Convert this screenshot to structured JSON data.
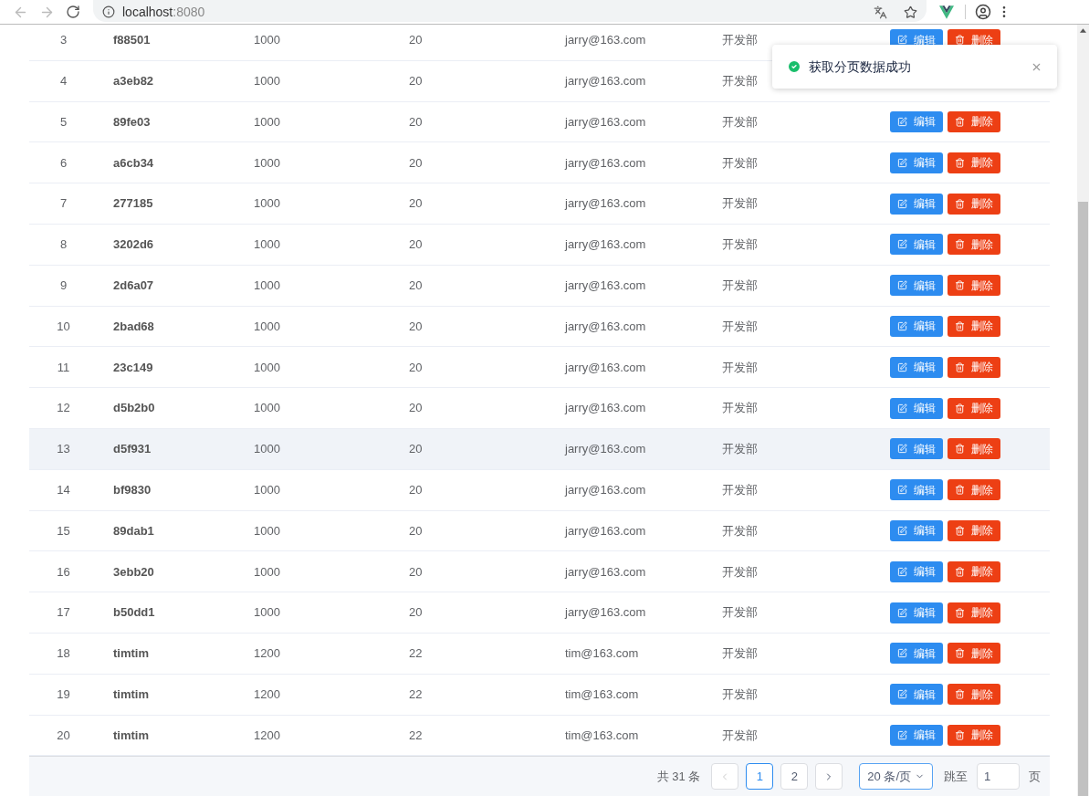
{
  "browser": {
    "url_host": "localhost",
    "url_port": ":8080"
  },
  "rows": [
    {
      "index": "3",
      "name": "f88501",
      "salary": "1000",
      "age": "20",
      "email": "jarry@163.com",
      "dept": "开发部",
      "hovered": false,
      "actions": [
        "编辑",
        "删除"
      ]
    },
    {
      "index": "4",
      "name": "a3eb82",
      "salary": "1000",
      "age": "20",
      "email": "jarry@163.com",
      "dept": "开发部",
      "hovered": false
    },
    {
      "index": "5",
      "name": "89fe03",
      "salary": "1000",
      "age": "20",
      "email": "jarry@163.com",
      "dept": "开发部",
      "hovered": false,
      "actions": [
        "编辑",
        "删除"
      ]
    },
    {
      "index": "6",
      "name": "a6cb34",
      "salary": "1000",
      "age": "20",
      "email": "jarry@163.com",
      "dept": "开发部",
      "hovered": false,
      "actions": [
        "编辑",
        "删除"
      ]
    },
    {
      "index": "7",
      "name": "277185",
      "salary": "1000",
      "age": "20",
      "email": "jarry@163.com",
      "dept": "开发部",
      "hovered": false,
      "actions": [
        "编辑",
        "删除"
      ]
    },
    {
      "index": "8",
      "name": "3202d6",
      "salary": "1000",
      "age": "20",
      "email": "jarry@163.com",
      "dept": "开发部",
      "hovered": false,
      "actions": [
        "编辑",
        "删除"
      ]
    },
    {
      "index": "9",
      "name": "2d6a07",
      "salary": "1000",
      "age": "20",
      "email": "jarry@163.com",
      "dept": "开发部",
      "hovered": false,
      "actions": [
        "编辑",
        "删除"
      ]
    },
    {
      "index": "10",
      "name": "2bad68",
      "salary": "1000",
      "age": "20",
      "email": "jarry@163.com",
      "dept": "开发部",
      "hovered": false,
      "actions": [
        "编辑",
        "删除"
      ]
    },
    {
      "index": "11",
      "name": "23c149",
      "salary": "1000",
      "age": "20",
      "email": "jarry@163.com",
      "dept": "开发部",
      "hovered": false,
      "actions": [
        "编辑",
        "删除"
      ]
    },
    {
      "index": "12",
      "name": "d5b2b0",
      "salary": "1000",
      "age": "20",
      "email": "jarry@163.com",
      "dept": "开发部",
      "hovered": false,
      "actions": [
        "编辑",
        "删除"
      ]
    },
    {
      "index": "13",
      "name": "d5f931",
      "salary": "1000",
      "age": "20",
      "email": "jarry@163.com",
      "dept": "开发部",
      "hovered": true,
      "actions": [
        "编辑",
        "删除"
      ]
    },
    {
      "index": "14",
      "name": "bf9830",
      "salary": "1000",
      "age": "20",
      "email": "jarry@163.com",
      "dept": "开发部",
      "hovered": false,
      "actions": [
        "编辑",
        "删除"
      ]
    },
    {
      "index": "15",
      "name": "89dab1",
      "salary": "1000",
      "age": "20",
      "email": "jarry@163.com",
      "dept": "开发部",
      "hovered": false,
      "actions": [
        "编辑",
        "删除"
      ]
    },
    {
      "index": "16",
      "name": "3ebb20",
      "salary": "1000",
      "age": "20",
      "email": "jarry@163.com",
      "dept": "开发部",
      "hovered": false,
      "actions": [
        "编辑",
        "删除"
      ]
    },
    {
      "index": "17",
      "name": "b50dd1",
      "salary": "1000",
      "age": "20",
      "email": "jarry@163.com",
      "dept": "开发部",
      "hovered": false,
      "actions": [
        "编辑",
        "删除"
      ]
    },
    {
      "index": "18",
      "name": "timtim",
      "salary": "1200",
      "age": "22",
      "email": "tim@163.com",
      "dept": "开发部",
      "hovered": false,
      "actions": [
        "编辑",
        "删除"
      ]
    },
    {
      "index": "19",
      "name": "timtim",
      "salary": "1200",
      "age": "22",
      "email": "tim@163.com",
      "dept": "开发部",
      "hovered": false,
      "actions": [
        "编辑",
        "删除"
      ]
    },
    {
      "index": "20",
      "name": "timtim",
      "salary": "1200",
      "age": "22",
      "email": "tim@163.com",
      "dept": "开发部",
      "hovered": false,
      "actions": [
        "编辑",
        "删除"
      ]
    }
  ],
  "pagination": {
    "total": "共 31 条",
    "pages": [
      {
        "label": "1",
        "selected": true
      },
      {
        "label": "2",
        "selected": false
      }
    ],
    "page_size": "20 条/页",
    "jump_label": "跳至",
    "jump_value": "1",
    "page_suffix": "页"
  },
  "toast": {
    "message": "获取分页数据成功"
  }
}
